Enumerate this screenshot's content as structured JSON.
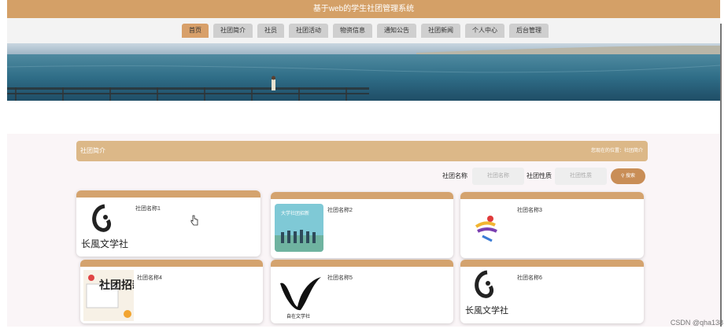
{
  "header": {
    "title": "基于web的学生社团管理系统"
  },
  "nav": {
    "items": [
      {
        "label": "首页",
        "active": true
      },
      {
        "label": "社团简介",
        "active": false
      },
      {
        "label": "社员",
        "active": false
      },
      {
        "label": "社团活动",
        "active": false
      },
      {
        "label": "物资信息",
        "active": false
      },
      {
        "label": "通知公告",
        "active": false
      },
      {
        "label": "社团新闻",
        "active": false
      },
      {
        "label": "个人中心",
        "active": false
      },
      {
        "label": "后台管理",
        "active": false
      }
    ]
  },
  "section": {
    "title": "社团简介",
    "breadcrumb": "您现在的位置：社团简介"
  },
  "search": {
    "name_label": "社团名称",
    "name_placeholder": "社团名称",
    "type_label": "社团性质",
    "type_placeholder": "社团性质",
    "button_label": "搜索",
    "button_icon": "search-icon"
  },
  "clubs": [
    {
      "name": "社团名称1"
    },
    {
      "name": "社团名称2"
    },
    {
      "name": "社团名称3"
    },
    {
      "name": "社团名称4"
    },
    {
      "name": "社团名称5"
    },
    {
      "name": "社团名称6"
    }
  ],
  "logos": {
    "club1_text": "长風文学社",
    "club2_banner": "大学社团招新",
    "club4_text": "社团招新",
    "club5_text": "自在文学社",
    "club6_text": "长風文学社"
  },
  "colors": {
    "accent": "#d4a067",
    "card_cap": "#d4a36e",
    "button": "#c98e57"
  },
  "watermark": "CSDN @qha138"
}
